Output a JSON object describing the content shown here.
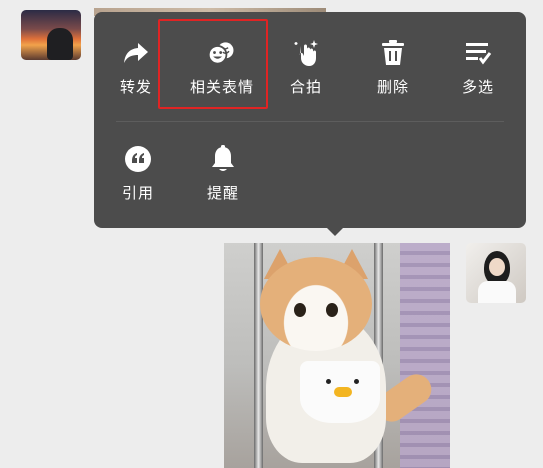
{
  "menu": {
    "row1": [
      {
        "label": "转发",
        "icon": "share-forward-icon"
      },
      {
        "label": "相关表情",
        "icon": "related-emoji-icon"
      },
      {
        "label": "合拍",
        "icon": "co-shoot-icon"
      },
      {
        "label": "删除",
        "icon": "trash-icon"
      },
      {
        "label": "多选",
        "icon": "multi-select-icon"
      }
    ],
    "row2": [
      {
        "label": "引用",
        "icon": "quote-icon"
      },
      {
        "label": "提醒",
        "icon": "bell-icon"
      }
    ]
  },
  "colors": {
    "menu_bg": "#4c4c4c",
    "menu_text": "#ffffff",
    "highlight_border": "#e02424",
    "page_bg": "#ededed"
  }
}
